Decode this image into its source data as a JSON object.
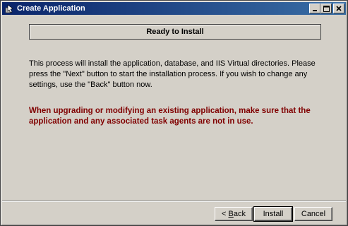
{
  "window": {
    "title": "Create Application",
    "icon": "setup-wizard-icon"
  },
  "header": {
    "title": "Ready to Install"
  },
  "body": {
    "description": "This process will install the application, database, and IIS Virtual directories. Please press the \"Next\" button to start the installation process. If you wish to change any settings, use the \"Back\" button now.",
    "warning": "When upgrading or modifying an existing application, make sure that the application and any associated task agents are not in use."
  },
  "buttons": {
    "back_label_mnemonic": "B",
    "back_label_rest": "ack",
    "back_prefix": "< ",
    "install_label": "Install",
    "cancel_label": "Cancel"
  },
  "colors": {
    "titlebar_start": "#0a246a",
    "titlebar_end": "#3a6ea5",
    "warning": "#800000",
    "face": "#d4d0c8"
  }
}
